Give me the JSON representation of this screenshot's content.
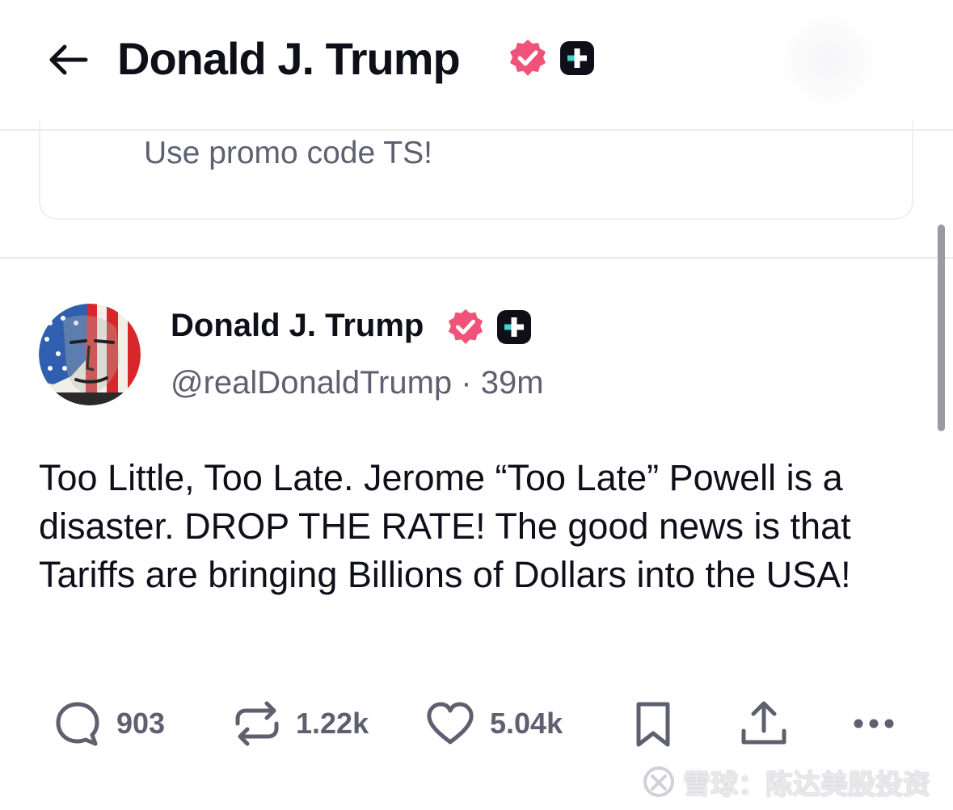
{
  "header": {
    "title": "Donald J. Trump"
  },
  "promo": {
    "text": "Use promo code TS!"
  },
  "post": {
    "author_name": "Donald J. Trump",
    "handle": "@realDonaldTrump",
    "separator": "·",
    "time": "39m",
    "text": "Too Little, Too Late. Jerome “Too Late” Powell is a disaster. DROP THE RATE! The good news is that Tariffs are bringing Billions of Dollars into the USA!",
    "actions": {
      "replies": "903",
      "retruths": "1.22k",
      "likes": "5.04k"
    }
  },
  "watermark": {
    "text": "雪球：陈达美股投资"
  },
  "icons": {
    "back": "arrow-left-icon",
    "verified": "verified-badge-icon",
    "plus": "plus-badge-icon",
    "reply": "comment-bubble-icon",
    "retruth": "repost-icon",
    "like": "heart-icon",
    "bookmark": "bookmark-icon",
    "share": "share-icon",
    "more": "more-dots-icon"
  },
  "colors": {
    "verified": "#f0527a",
    "plus_badge_bg": "#0f0f1a",
    "plus_badge_cross": "#3fd3c9",
    "muted_text": "#5e6070",
    "icon_gray": "#5e6070"
  }
}
